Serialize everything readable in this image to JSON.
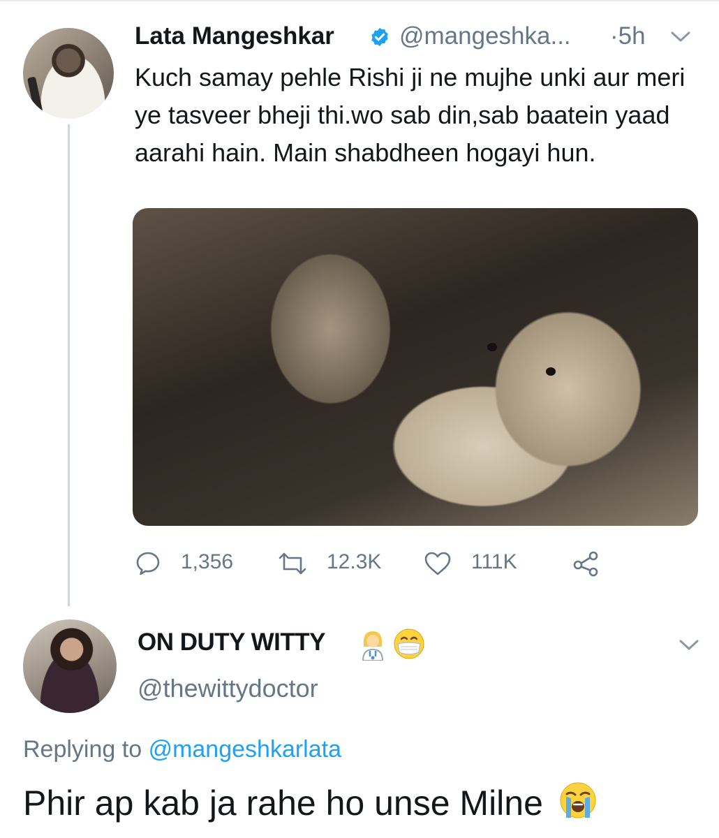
{
  "tweet": {
    "author_name": "Lata Mangeshkar",
    "author_handle": "@mangeshka...",
    "time": "·5h",
    "text": "Kuch samay pehle Rishi ji ne mujhe unki aur meri ye tasveer bheji thi.wo sab din,sab baatein yaad aarahi hain. Main shabdheen hogayi hun.",
    "replies": "1,356",
    "retweets": "12.3K",
    "likes": "111K",
    "icons": [
      "verified-badge-icon",
      "chevron-down-icon",
      "reply-icon",
      "retweet-icon",
      "like-icon",
      "share-icon"
    ]
  },
  "reply": {
    "author_name": "ON DUTY WITTY",
    "author_handle": "@thewittydoctor",
    "replying_label": "Replying to",
    "replying_to": "@mangeshkarlata",
    "text": "Phir ap kab ja rahe ho unse Milne",
    "icons": [
      "health-worker-emoji-icon",
      "mask-face-emoji-icon",
      "crying-face-emoji-icon",
      "chevron-down-icon"
    ]
  },
  "colors": {
    "text": "#14171a",
    "muted": "#657786",
    "link": "#1da1f2",
    "verified": "#1da1f2"
  }
}
